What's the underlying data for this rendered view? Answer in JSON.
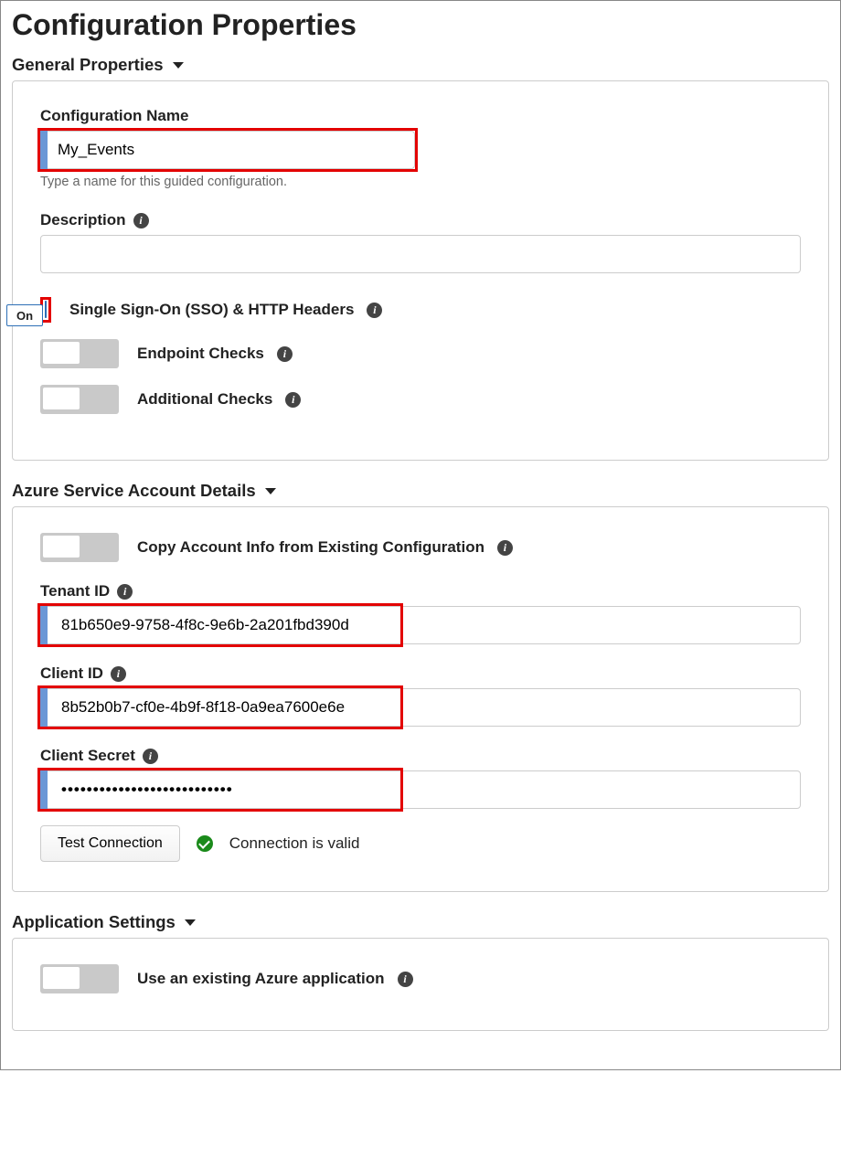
{
  "page_title": "Configuration Properties",
  "sections": {
    "general": {
      "header": "General Properties",
      "config_name": {
        "label": "Configuration Name",
        "value": "My_Events",
        "hint": "Type a name for this guided configuration."
      },
      "description": {
        "label": "Description",
        "value": ""
      },
      "toggles": {
        "sso": {
          "label": "Single Sign-On (SSO) & HTTP Headers",
          "state": "On"
        },
        "endpoint": {
          "label": "Endpoint Checks"
        },
        "additional": {
          "label": "Additional Checks"
        }
      }
    },
    "azure": {
      "header": "Azure Service Account Details",
      "copy_toggle": {
        "label": "Copy Account Info from Existing Configuration"
      },
      "tenant_id": {
        "label": "Tenant ID",
        "value": "81b650e9-9758-4f8c-9e6b-2a201fbd390d"
      },
      "client_id": {
        "label": "Client ID",
        "value": "8b52b0b7-cf0e-4b9f-8f18-0a9ea7600e6e"
      },
      "client_secret": {
        "label": "Client Secret",
        "value": "•••••••••••••••••••••••••••"
      },
      "test_btn": "Test Connection",
      "status": "Connection is valid"
    },
    "appsettings": {
      "header": "Application Settings",
      "use_existing": {
        "label": "Use an existing Azure application"
      }
    }
  }
}
